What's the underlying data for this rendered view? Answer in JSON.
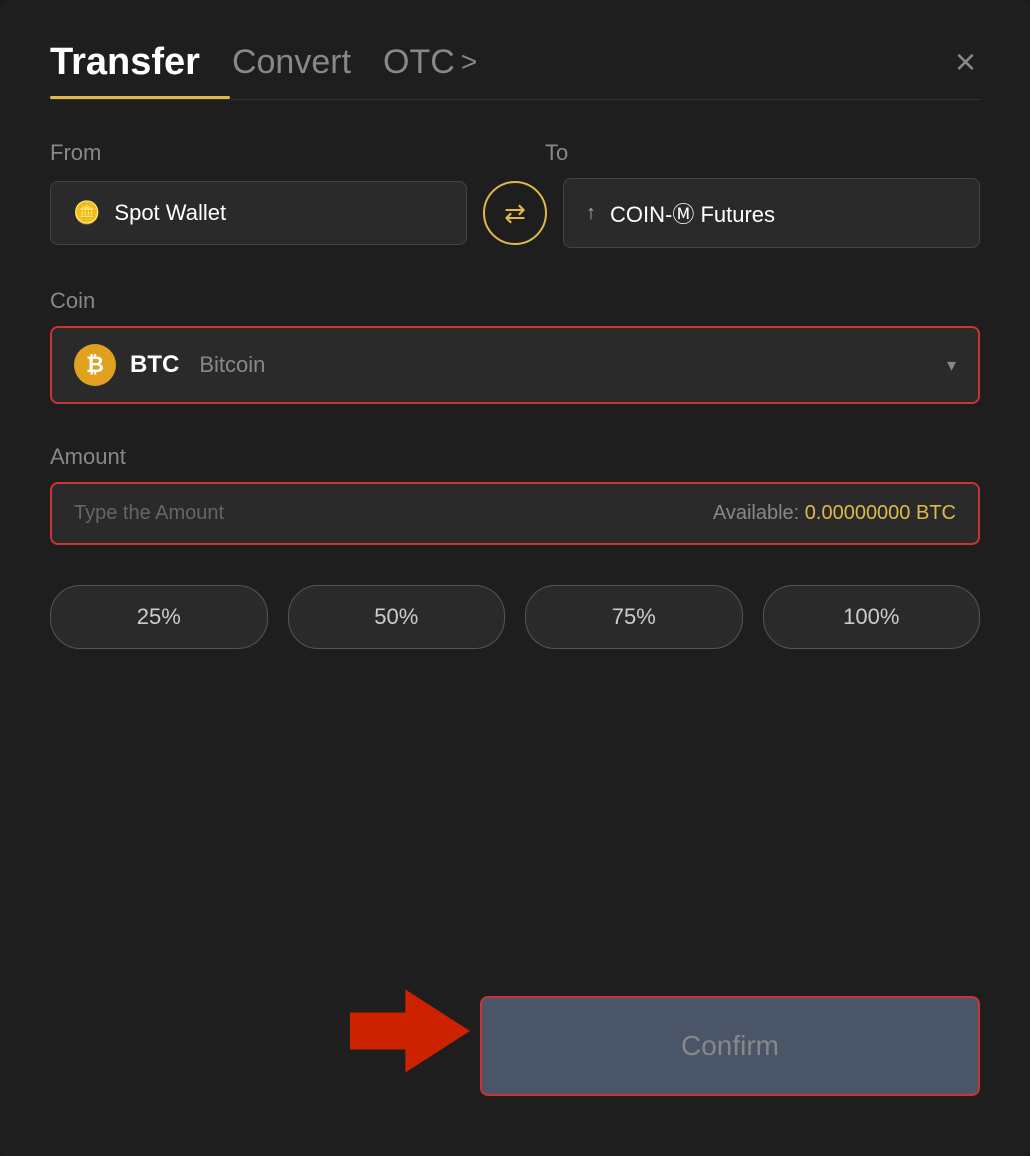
{
  "header": {
    "tab_transfer": "Transfer",
    "tab_convert": "Convert",
    "tab_otc": "OTC",
    "tab_otc_chevron": ">",
    "close_icon": "×"
  },
  "from_section": {
    "label": "From",
    "wallet_icon": "▬",
    "wallet_name": "Spot Wallet"
  },
  "to_section": {
    "label": "To",
    "futures_icon": "↑",
    "futures_name": "COIN-Ⓜ Futures"
  },
  "swap": {
    "icon": "⇆"
  },
  "coin_section": {
    "label": "Coin",
    "coin_symbol": "BTC",
    "coin_name": "Bitcoin",
    "coin_icon": "₿",
    "chevron": "▾"
  },
  "amount_section": {
    "label": "Amount",
    "placeholder": "Type the Amount",
    "available_label": "Available:",
    "available_value": "0.00000000 BTC"
  },
  "percent_buttons": [
    {
      "label": "25%",
      "value": "25"
    },
    {
      "label": "50%",
      "value": "50"
    },
    {
      "label": "75%",
      "value": "75"
    },
    {
      "label": "100%",
      "value": "100"
    }
  ],
  "confirm_button": {
    "label": "Confirm"
  }
}
